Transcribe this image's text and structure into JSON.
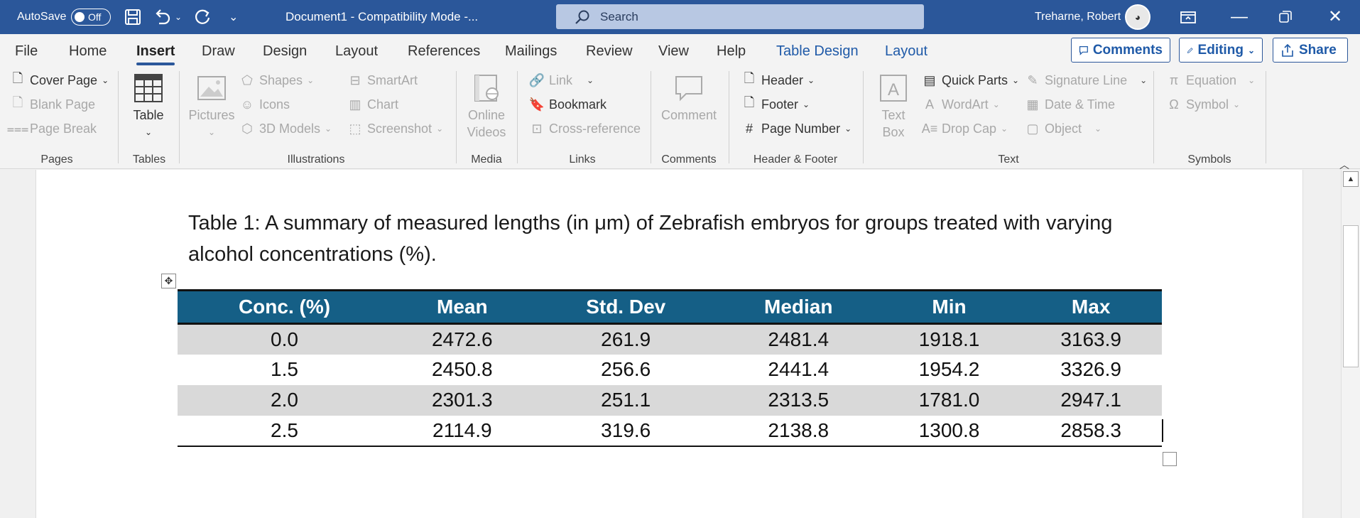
{
  "titlebar": {
    "autosave_label": "AutoSave",
    "autosave_state": "Off",
    "doc_title": "Document1  -  Compatibility Mode  -...",
    "search_placeholder": "Search",
    "user_name": "Treharne, Robert"
  },
  "tabs": [
    "File",
    "Home",
    "Insert",
    "Draw",
    "Design",
    "Layout",
    "References",
    "Mailings",
    "Review",
    "View",
    "Help",
    "Table Design",
    "Layout"
  ],
  "ribbon_buttons": {
    "comments": "Comments",
    "editing": "Editing",
    "share": "Share"
  },
  "ribbon": {
    "pages": {
      "cover_page": "Cover Page",
      "blank_page": "Blank Page",
      "page_break": "Page Break",
      "label": "Pages"
    },
    "tables": {
      "table": "Table",
      "label": "Tables"
    },
    "illustrations": {
      "pictures": "Pictures",
      "shapes": "Shapes",
      "icons": "Icons",
      "models_3d": "3D Models",
      "smartart": "SmartArt",
      "chart": "Chart",
      "screenshot": "Screenshot",
      "label": "Illustrations"
    },
    "media": {
      "online_videos_1": "Online",
      "online_videos_2": "Videos",
      "label": "Media"
    },
    "links": {
      "link": "Link",
      "bookmark": "Bookmark",
      "cross_reference": "Cross-reference",
      "label": "Links"
    },
    "comments": {
      "comment": "Comment",
      "label": "Comments"
    },
    "header_footer": {
      "header": "Header",
      "footer": "Footer",
      "page_number": "Page Number",
      "label": "Header & Footer"
    },
    "text": {
      "text_box_1": "Text",
      "text_box_2": "Box",
      "quick_parts": "Quick Parts",
      "wordart": "WordArt",
      "drop_cap": "Drop Cap",
      "signature_line": "Signature Line",
      "date_time": "Date & Time",
      "object": "Object",
      "label": "Text"
    },
    "symbols": {
      "equation": "Equation",
      "symbol": "Symbol",
      "label": "Symbols"
    }
  },
  "document": {
    "caption": "Table 1: A summary of measured lengths (in μm) of Zebrafish embryos for groups treated with varying alcohol concentrations (%).",
    "table": {
      "headers": [
        "Conc. (%)",
        "Mean",
        "Std. Dev",
        "Median",
        "Min",
        "Max"
      ],
      "rows": [
        [
          "0.0",
          "2472.6",
          "261.9",
          "2481.4",
          "1918.1",
          "3163.9"
        ],
        [
          "1.5",
          "2450.8",
          "256.6",
          "2441.4",
          "1954.2",
          "3326.9"
        ],
        [
          "2.0",
          "2301.3",
          "251.1",
          "2313.5",
          "1781.0",
          "2947.1"
        ],
        [
          "2.5",
          "2114.9",
          "319.6",
          "2138.8",
          "1300.8",
          "2858.3"
        ]
      ]
    }
  },
  "colors": {
    "title_bar": "#2b579a",
    "table_header": "#155f86",
    "row_shade": "#d9d9d9",
    "accent": "#1f5aa8"
  }
}
